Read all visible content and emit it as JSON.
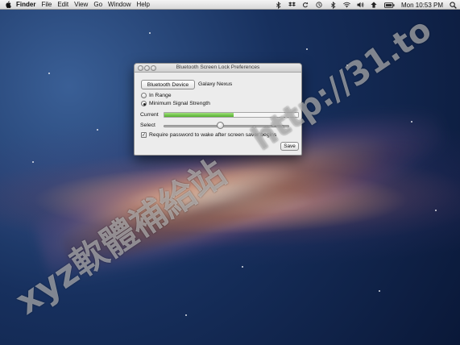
{
  "menubar": {
    "items": [
      "Finder",
      "File",
      "Edit",
      "View",
      "Go",
      "Window",
      "Help"
    ],
    "clock": "Mon 10:53 PM",
    "status_icons": [
      "bluetooth-icon",
      "dropbox-icon",
      "sync-icon",
      "time-machine-icon",
      "bluetooth-status-icon",
      "wifi-icon",
      "volume-icon",
      "input-icon",
      "battery-icon"
    ]
  },
  "window": {
    "title": "Bluetooth Screen Lock Preferences",
    "device_button": "Bluetooth Device",
    "device_name": "Galaxy Nexus",
    "radio_in_range": "In Range",
    "radio_min_signal": "Minimum Signal Strength",
    "selected_radio": "Minimum Signal Strength",
    "current_label": "Current",
    "current_level": 0.52,
    "select_label": "Select",
    "select_value": 0.45,
    "checkbox_label": "Require password to wake after screen saver begins",
    "checkbox_checked": true,
    "save_label": "Save"
  },
  "watermark": {
    "line1": "xyz軟體補給站",
    "line2": "http://31.to"
  },
  "colors": {
    "level_fill": "#6cc43f",
    "menubar": "#e6e6e6"
  }
}
